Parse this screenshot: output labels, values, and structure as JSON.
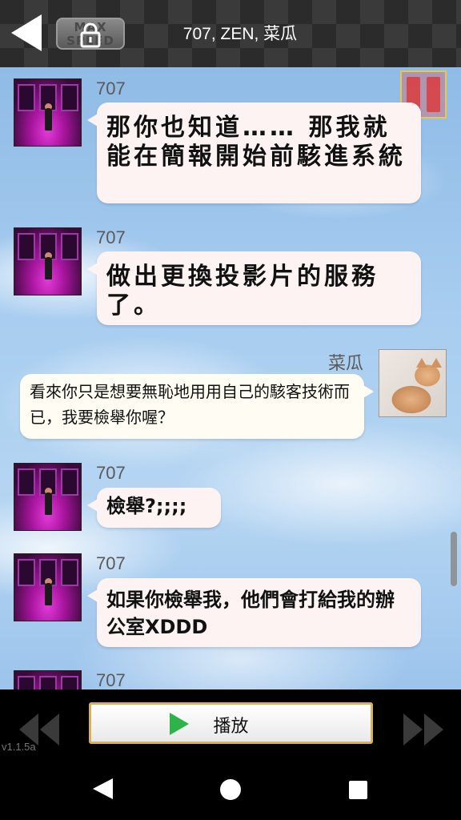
{
  "header": {
    "title": "707, ZEN, 菜瓜",
    "max_speed_label": "MAX SPEED"
  },
  "messages": [
    {
      "sender": "707",
      "text": "那你也知道…… 那我就能在簡報開始前駭進系統",
      "side": "left"
    },
    {
      "sender": "707",
      "text": "做出更換投影片的服務了。",
      "side": "left"
    },
    {
      "sender": "菜瓜",
      "text": "看來你只是想要無恥地用用自己的駭客技術而已，我要檢舉你喔？",
      "side": "right"
    },
    {
      "sender": "707",
      "text": "檢舉?;;;;",
      "side": "left"
    },
    {
      "sender": "707",
      "text": "如果你檢舉我，他們會打給我的辦公室XDDD",
      "side": "left"
    },
    {
      "sender": "707",
      "text": "",
      "side": "left"
    }
  ],
  "controls": {
    "play_label": "播放",
    "version": "v1.1.5a"
  },
  "icons": {
    "back": "back-arrow-icon",
    "lock": "lock-icon",
    "pause": "pause-icon",
    "rewind": "rewind-icon",
    "fast_forward": "fast-forward-icon",
    "play": "play-icon"
  },
  "colors": {
    "play_icon": "#2db34a",
    "play_border": "#d8b25a",
    "pause_border": "#e8c84a"
  }
}
